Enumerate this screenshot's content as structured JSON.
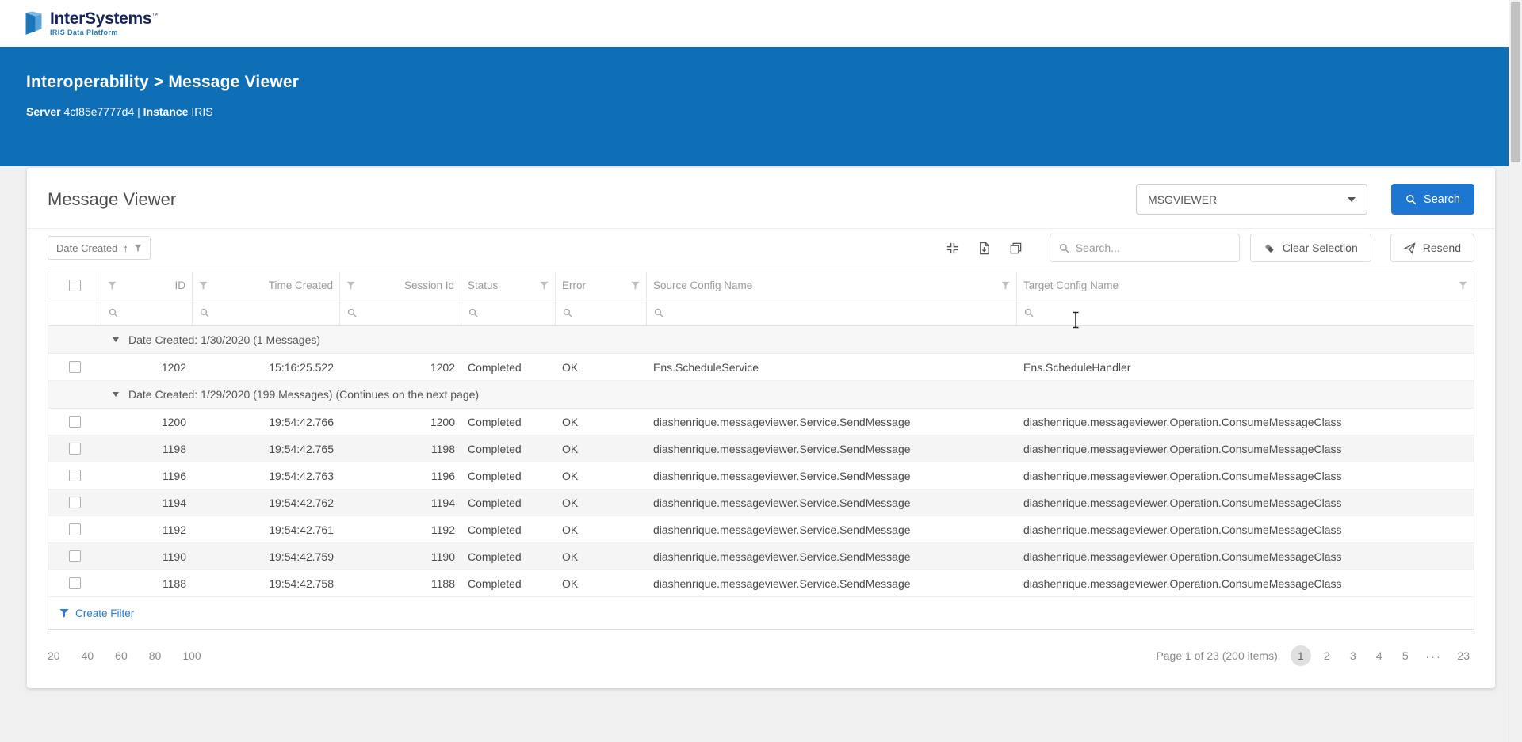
{
  "topbar": {
    "brand": "InterSystems",
    "brand_tm": "™",
    "brand_sub": "IRIS Data Platform"
  },
  "hero": {
    "title": "Interoperability > Message Viewer",
    "server_label": "Server",
    "server_value": "4cf85e7777d4",
    "divider": "|",
    "instance_label": "Instance",
    "instance_value": "IRIS"
  },
  "panel": {
    "title": "Message Viewer",
    "namespace_selected": "MSGVIEWER",
    "search_button": "Search"
  },
  "toolbar": {
    "group_chip": "Date Created",
    "sort_arrow": "↑",
    "search_placeholder": "Search...",
    "clear_selection": "Clear Selection",
    "resend": "Resend"
  },
  "grid": {
    "columns": [
      "ID",
      "Time Created",
      "Session Id",
      "Status",
      "Error",
      "Source Config Name",
      "Target Config Name"
    ],
    "groups": [
      {
        "label": "Date Created: 1/30/2020 (1 Messages)",
        "rows": [
          {
            "id": "1202",
            "time": "15:16:25.522",
            "session": "1202",
            "status": "Completed",
            "error": "OK",
            "source": "Ens.ScheduleService",
            "target": "Ens.ScheduleHandler"
          }
        ]
      },
      {
        "label": "Date Created: 1/29/2020 (199 Messages) (Continues on the next page)",
        "rows": [
          {
            "id": "1200",
            "time": "19:54:42.766",
            "session": "1200",
            "status": "Completed",
            "error": "OK",
            "source": "diashenrique.messageviewer.Service.SendMessage",
            "target": "diashenrique.messageviewer.Operation.ConsumeMessageClass"
          },
          {
            "id": "1198",
            "time": "19:54:42.765",
            "session": "1198",
            "status": "Completed",
            "error": "OK",
            "source": "diashenrique.messageviewer.Service.SendMessage",
            "target": "diashenrique.messageviewer.Operation.ConsumeMessageClass"
          },
          {
            "id": "1196",
            "time": "19:54:42.763",
            "session": "1196",
            "status": "Completed",
            "error": "OK",
            "source": "diashenrique.messageviewer.Service.SendMessage",
            "target": "diashenrique.messageviewer.Operation.ConsumeMessageClass"
          },
          {
            "id": "1194",
            "time": "19:54:42.762",
            "session": "1194",
            "status": "Completed",
            "error": "OK",
            "source": "diashenrique.messageviewer.Service.SendMessage",
            "target": "diashenrique.messageviewer.Operation.ConsumeMessageClass"
          },
          {
            "id": "1192",
            "time": "19:54:42.761",
            "session": "1192",
            "status": "Completed",
            "error": "OK",
            "source": "diashenrique.messageviewer.Service.SendMessage",
            "target": "diashenrique.messageviewer.Operation.ConsumeMessageClass"
          },
          {
            "id": "1190",
            "time": "19:54:42.759",
            "session": "1190",
            "status": "Completed",
            "error": "OK",
            "source": "diashenrique.messageviewer.Service.SendMessage",
            "target": "diashenrique.messageviewer.Operation.ConsumeMessageClass"
          },
          {
            "id": "1188",
            "time": "19:54:42.758",
            "session": "1188",
            "status": "Completed",
            "error": "OK",
            "source": "diashenrique.messageviewer.Service.SendMessage",
            "target": "diashenrique.messageviewer.Operation.ConsumeMessageClass"
          }
        ]
      }
    ],
    "create_filter": "Create Filter"
  },
  "pager": {
    "sizes": [
      "20",
      "40",
      "60",
      "80",
      "100"
    ],
    "info": "Page 1 of 23 (200 items)",
    "pages": [
      "1",
      "2",
      "3",
      "4",
      "5",
      "...",
      "23"
    ],
    "active_page": "1"
  },
  "colors": {
    "hero_blue": "#0e6eb6",
    "primary_button_blue": "#1d76d2",
    "link_blue": "#2a7cd4"
  }
}
